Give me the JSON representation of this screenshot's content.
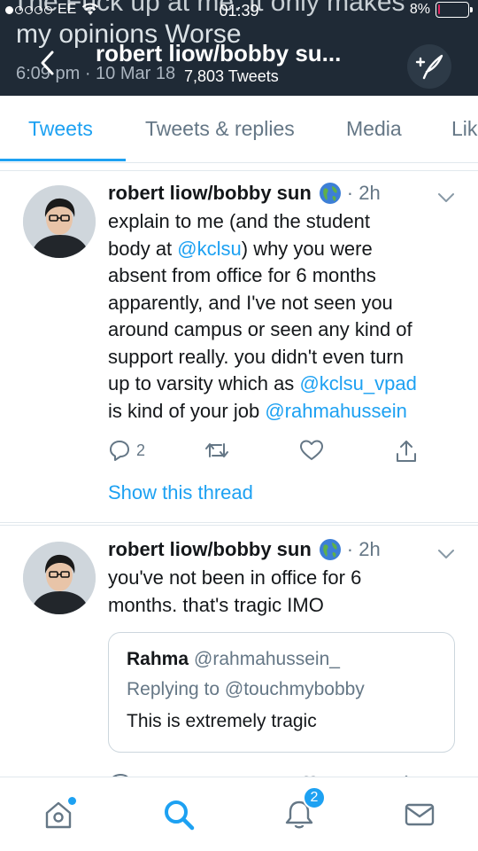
{
  "status_bar": {
    "carrier": "EE",
    "time": "01:39",
    "battery": "8%",
    "battery_level": 0.08
  },
  "header": {
    "bg_line1": "The Fuck up  at me. It only makes",
    "bg_line2": "my opinions Worse",
    "bg_line3": "6:09 pm · 10 Mar 18",
    "profile_name": "robert liow/bobby su...",
    "tweet_count": "7,803 Tweets"
  },
  "tabs": [
    {
      "label": "Tweets",
      "active": true
    },
    {
      "label": "Tweets & replies",
      "active": false
    },
    {
      "label": "Media",
      "active": false
    },
    {
      "label": "Lik",
      "active": false
    }
  ],
  "tweets": [
    {
      "author": "robert liow/bobby sun",
      "time": "· 2h",
      "lines": [
        "explain to me (and the student",
        "body at ",
        "@kclsu",
        ") why you were",
        "absent from office for 6 months",
        "apparently, and I've not seen you",
        "around campus or seen any kind of",
        "support really. you didn't even turn",
        "up to varsity which as ",
        "@kclsu_vpad",
        "is kind of your job ",
        "@rahmahussein"
      ],
      "reply_count": "2",
      "show_thread": "Show this thread"
    },
    {
      "author": "robert liow/bobby sun",
      "time": "· 2h",
      "lines": [
        "you've not been in office for 6",
        "months. that's tragic IMO"
      ],
      "quote": {
        "name": "Rahma",
        "handle": "@rahmahussein_",
        "replying": "Replying to @touchmybobby",
        "text": "This is extremely tragic"
      }
    }
  ],
  "bottom_nav": {
    "notification_badge": "2"
  },
  "colors": {
    "accent": "#1da1f2",
    "header_bg": "#1f2a36",
    "battery_low": "#e0245e"
  }
}
